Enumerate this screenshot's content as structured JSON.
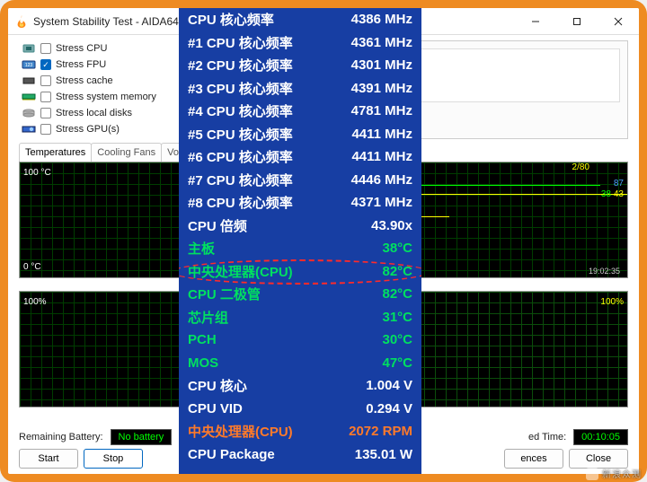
{
  "window": {
    "title": "System Stability Test - AIDA64",
    "controls": {
      "min": "minimize",
      "max": "maximize",
      "close": "close"
    }
  },
  "stress_options": [
    {
      "icon": "cpu-chip",
      "label": "Stress CPU",
      "checked": false
    },
    {
      "icon": "fpu-chip",
      "label": "Stress FPU",
      "checked": true
    },
    {
      "icon": "cache",
      "label": "Stress cache",
      "checked": false
    },
    {
      "icon": "ram",
      "label": "Stress system memory",
      "checked": false
    },
    {
      "icon": "disk",
      "label": "Stress local disks",
      "checked": false
    },
    {
      "icon": "gpu",
      "label": "Stress GPU(s)",
      "checked": false
    }
  ],
  "tabs": [
    "Temperatures",
    "Cooling Fans",
    "Volta"
  ],
  "active_tab": 0,
  "graphs": {
    "tl": {
      "top": "100 °C",
      "bottom": "0 °C"
    },
    "tr": {
      "legend": "2/80",
      "r1": "87",
      "r2": "43",
      "r2b": "38",
      "time": "19:02:35"
    },
    "bl": {
      "top": "100%"
    },
    "br": {
      "top": "100%"
    }
  },
  "battery": {
    "label": "Remaining Battery:",
    "value": "No battery"
  },
  "elapsed": {
    "label": "ed Time:",
    "value": "00:10:05"
  },
  "buttons": {
    "start": "Start",
    "stop": "Stop",
    "prefs": "ences",
    "close": "Close"
  },
  "overlay": {
    "rows": [
      {
        "cls": "freq",
        "k": "CPU 核心频率",
        "v": "4386 MHz"
      },
      {
        "cls": "freq",
        "k": "#1 CPU 核心频率",
        "v": "4361 MHz"
      },
      {
        "cls": "freq",
        "k": "#2 CPU 核心频率",
        "v": "4301 MHz"
      },
      {
        "cls": "freq",
        "k": "#3 CPU 核心频率",
        "v": "4391 MHz"
      },
      {
        "cls": "freq",
        "k": "#4 CPU 核心频率",
        "v": "4781 MHz"
      },
      {
        "cls": "freq",
        "k": "#5 CPU 核心频率",
        "v": "4411 MHz"
      },
      {
        "cls": "freq",
        "k": "#6 CPU 核心频率",
        "v": "4411 MHz"
      },
      {
        "cls": "freq",
        "k": "#7 CPU 核心频率",
        "v": "4446 MHz"
      },
      {
        "cls": "freq",
        "k": "#8 CPU 核心频率",
        "v": "4371 MHz"
      },
      {
        "cls": "mult",
        "k": "CPU 倍频",
        "v": "43.90x"
      },
      {
        "cls": "temp",
        "k": "主板",
        "v": "38°C"
      },
      {
        "cls": "temp",
        "k": "中央处理器(CPU)",
        "v": "82°C"
      },
      {
        "cls": "temp",
        "k": "CPU 二极管",
        "v": "82°C"
      },
      {
        "cls": "temp",
        "k": "芯片组",
        "v": "31°C"
      },
      {
        "cls": "temp",
        "k": "PCH",
        "v": "30°C"
      },
      {
        "cls": "temp",
        "k": "MOS",
        "v": "47°C"
      },
      {
        "cls": "volt",
        "k": "CPU 核心",
        "v": "1.004 V"
      },
      {
        "cls": "volt",
        "k": "CPU VID",
        "v": "0.294 V"
      },
      {
        "cls": "fan",
        "k": "中央处理器(CPU)",
        "v": "2072 RPM"
      },
      {
        "cls": "pkg",
        "k": "CPU Package",
        "v": "135.01 W"
      }
    ],
    "highlight_index": 11
  },
  "watermark": "新浪众测"
}
